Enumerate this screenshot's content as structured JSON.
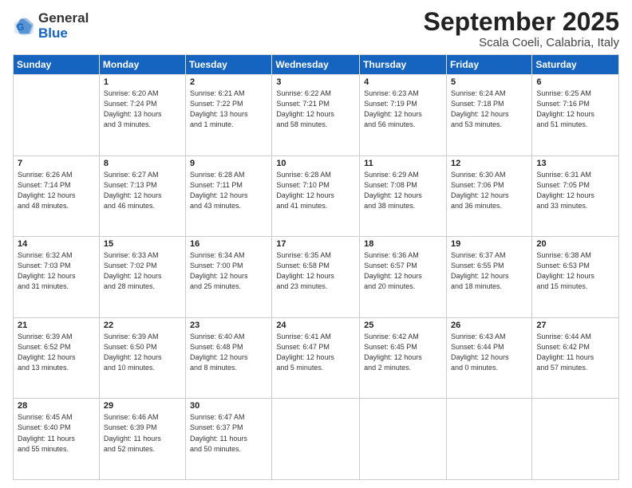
{
  "logo": {
    "general": "General",
    "blue": "Blue"
  },
  "title": "September 2025",
  "location": "Scala Coeli, Calabria, Italy",
  "days_of_week": [
    "Sunday",
    "Monday",
    "Tuesday",
    "Wednesday",
    "Thursday",
    "Friday",
    "Saturday"
  ],
  "weeks": [
    [
      {
        "num": "",
        "info": ""
      },
      {
        "num": "1",
        "info": "Sunrise: 6:20 AM\nSunset: 7:24 PM\nDaylight: 13 hours\nand 3 minutes."
      },
      {
        "num": "2",
        "info": "Sunrise: 6:21 AM\nSunset: 7:22 PM\nDaylight: 13 hours\nand 1 minute."
      },
      {
        "num": "3",
        "info": "Sunrise: 6:22 AM\nSunset: 7:21 PM\nDaylight: 12 hours\nand 58 minutes."
      },
      {
        "num": "4",
        "info": "Sunrise: 6:23 AM\nSunset: 7:19 PM\nDaylight: 12 hours\nand 56 minutes."
      },
      {
        "num": "5",
        "info": "Sunrise: 6:24 AM\nSunset: 7:18 PM\nDaylight: 12 hours\nand 53 minutes."
      },
      {
        "num": "6",
        "info": "Sunrise: 6:25 AM\nSunset: 7:16 PM\nDaylight: 12 hours\nand 51 minutes."
      }
    ],
    [
      {
        "num": "7",
        "info": "Sunrise: 6:26 AM\nSunset: 7:14 PM\nDaylight: 12 hours\nand 48 minutes."
      },
      {
        "num": "8",
        "info": "Sunrise: 6:27 AM\nSunset: 7:13 PM\nDaylight: 12 hours\nand 46 minutes."
      },
      {
        "num": "9",
        "info": "Sunrise: 6:28 AM\nSunset: 7:11 PM\nDaylight: 12 hours\nand 43 minutes."
      },
      {
        "num": "10",
        "info": "Sunrise: 6:28 AM\nSunset: 7:10 PM\nDaylight: 12 hours\nand 41 minutes."
      },
      {
        "num": "11",
        "info": "Sunrise: 6:29 AM\nSunset: 7:08 PM\nDaylight: 12 hours\nand 38 minutes."
      },
      {
        "num": "12",
        "info": "Sunrise: 6:30 AM\nSunset: 7:06 PM\nDaylight: 12 hours\nand 36 minutes."
      },
      {
        "num": "13",
        "info": "Sunrise: 6:31 AM\nSunset: 7:05 PM\nDaylight: 12 hours\nand 33 minutes."
      }
    ],
    [
      {
        "num": "14",
        "info": "Sunrise: 6:32 AM\nSunset: 7:03 PM\nDaylight: 12 hours\nand 31 minutes."
      },
      {
        "num": "15",
        "info": "Sunrise: 6:33 AM\nSunset: 7:02 PM\nDaylight: 12 hours\nand 28 minutes."
      },
      {
        "num": "16",
        "info": "Sunrise: 6:34 AM\nSunset: 7:00 PM\nDaylight: 12 hours\nand 25 minutes."
      },
      {
        "num": "17",
        "info": "Sunrise: 6:35 AM\nSunset: 6:58 PM\nDaylight: 12 hours\nand 23 minutes."
      },
      {
        "num": "18",
        "info": "Sunrise: 6:36 AM\nSunset: 6:57 PM\nDaylight: 12 hours\nand 20 minutes."
      },
      {
        "num": "19",
        "info": "Sunrise: 6:37 AM\nSunset: 6:55 PM\nDaylight: 12 hours\nand 18 minutes."
      },
      {
        "num": "20",
        "info": "Sunrise: 6:38 AM\nSunset: 6:53 PM\nDaylight: 12 hours\nand 15 minutes."
      }
    ],
    [
      {
        "num": "21",
        "info": "Sunrise: 6:39 AM\nSunset: 6:52 PM\nDaylight: 12 hours\nand 13 minutes."
      },
      {
        "num": "22",
        "info": "Sunrise: 6:39 AM\nSunset: 6:50 PM\nDaylight: 12 hours\nand 10 minutes."
      },
      {
        "num": "23",
        "info": "Sunrise: 6:40 AM\nSunset: 6:48 PM\nDaylight: 12 hours\nand 8 minutes."
      },
      {
        "num": "24",
        "info": "Sunrise: 6:41 AM\nSunset: 6:47 PM\nDaylight: 12 hours\nand 5 minutes."
      },
      {
        "num": "25",
        "info": "Sunrise: 6:42 AM\nSunset: 6:45 PM\nDaylight: 12 hours\nand 2 minutes."
      },
      {
        "num": "26",
        "info": "Sunrise: 6:43 AM\nSunset: 6:44 PM\nDaylight: 12 hours\nand 0 minutes."
      },
      {
        "num": "27",
        "info": "Sunrise: 6:44 AM\nSunset: 6:42 PM\nDaylight: 11 hours\nand 57 minutes."
      }
    ],
    [
      {
        "num": "28",
        "info": "Sunrise: 6:45 AM\nSunset: 6:40 PM\nDaylight: 11 hours\nand 55 minutes."
      },
      {
        "num": "29",
        "info": "Sunrise: 6:46 AM\nSunset: 6:39 PM\nDaylight: 11 hours\nand 52 minutes."
      },
      {
        "num": "30",
        "info": "Sunrise: 6:47 AM\nSunset: 6:37 PM\nDaylight: 11 hours\nand 50 minutes."
      },
      {
        "num": "",
        "info": ""
      },
      {
        "num": "",
        "info": ""
      },
      {
        "num": "",
        "info": ""
      },
      {
        "num": "",
        "info": ""
      }
    ]
  ]
}
